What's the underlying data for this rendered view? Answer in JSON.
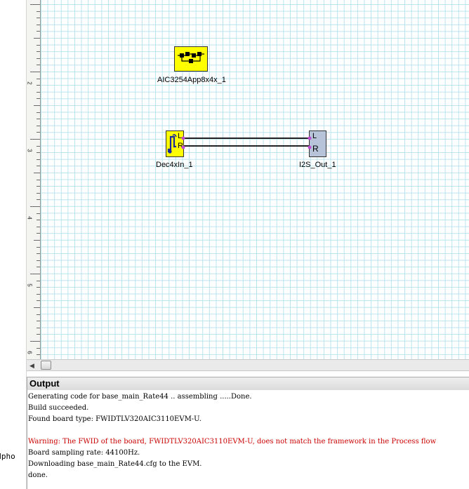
{
  "left_panel": {
    "text": "eadpho"
  },
  "ruler": {
    "labels": [
      "2",
      "3",
      "4",
      "5",
      "6"
    ]
  },
  "canvas": {
    "blocks": [
      {
        "id": "aic",
        "label": "AIC3254App8x4x_1",
        "color": "#ffff00",
        "icon": "processing-chain-icon"
      },
      {
        "id": "dec",
        "label": "Dec4xIn_1",
        "color": "#ffff00",
        "icon": "audio-input-icon",
        "ports": [
          "L",
          "R"
        ]
      },
      {
        "id": "i2s",
        "label": "I2S_Out_1",
        "color": "#b6c3d8",
        "icon": "i2s-output-icon",
        "ports": [
          "L",
          "R"
        ]
      }
    ]
  },
  "output": {
    "title": "Output",
    "lines": [
      {
        "text": "Generating code for base_main_Rate44 ..  assembling .....Done.",
        "color": "#000000"
      },
      {
        "text": "Build succeeded.",
        "color": "#000000"
      },
      {
        "text": "Found board type: FWIDTLV320AIC3110EVM-U.",
        "color": "#000000"
      },
      {
        "text": "",
        "color": "#000000"
      },
      {
        "text": "Warning:  The FWID of the board, FWIDTLV320AIC3110EVM-U, does not match the framework in the Process flow",
        "color": "#cc0000"
      },
      {
        "text": "Board sampling rate: 44100Hz.",
        "color": "#000000"
      },
      {
        "text": "Downloading base_main_Rate44.cfg to the EVM.",
        "color": "#000000"
      },
      {
        "text": "done.",
        "color": "#000000"
      }
    ]
  },
  "scrollbar": {
    "left_arrow": "◀"
  }
}
